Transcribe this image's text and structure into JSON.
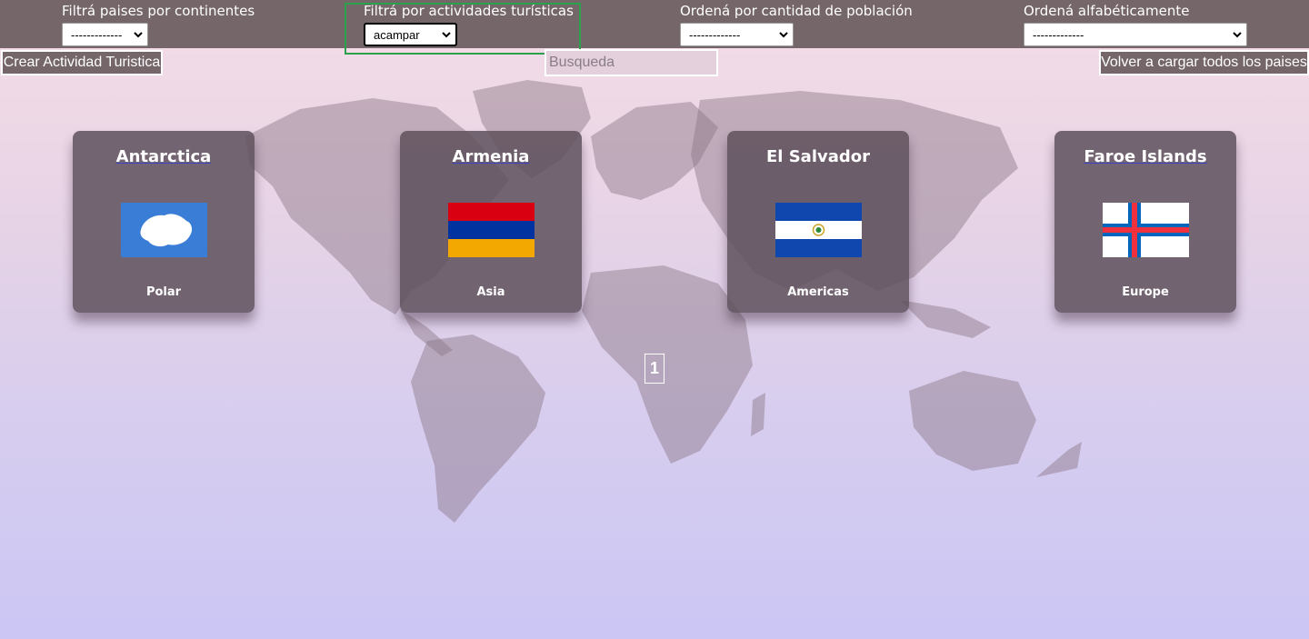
{
  "filters": {
    "continent": {
      "label": "Filtrá paises por continentes",
      "value": "-------------"
    },
    "activity": {
      "label": "Filtrá por actividades turísticas",
      "value": "acampar"
    },
    "population": {
      "label": "Ordená por cantidad de población",
      "value": "-------------"
    },
    "alphabetical": {
      "label": "Ordená alfabéticamente",
      "value": "-------------"
    }
  },
  "actions": {
    "create_label": "Crear Actividad Turistica",
    "reload_label": "Volver a cargar todos los paises",
    "search_placeholder": "Busqueda"
  },
  "countries": [
    {
      "name": "Antarctica",
      "continent": "Polar",
      "flag": "antarctica-flag"
    },
    {
      "name": "Armenia",
      "continent": "Asia",
      "flag": "armenia-flag"
    },
    {
      "name": "El Salvador",
      "continent": "Americas",
      "flag": "el-salvador-flag"
    },
    {
      "name": "Faroe Islands",
      "continent": "Europe",
      "flag": "faroe-islands-flag"
    }
  ],
  "pagination": {
    "current": "1"
  },
  "colors": {
    "topbar": "#746669",
    "card": "#5e505c",
    "highlight": "#2aa14a",
    "link_underline": "#3c43c8"
  }
}
